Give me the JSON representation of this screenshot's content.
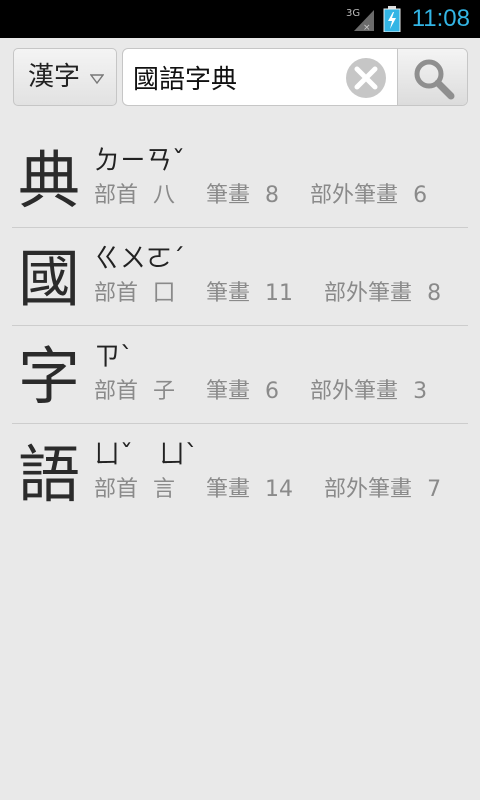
{
  "status_bar": {
    "network": "3G",
    "time": "11:08",
    "accent_color": "#33b5e5"
  },
  "search": {
    "mode_label": "漢字",
    "query": "國語字典",
    "clear_icon": "clear-icon",
    "search_icon": "search-icon"
  },
  "results": [
    {
      "char": "典",
      "zhuyin": "ㄉㄧㄢˇ",
      "radical_label": "部首",
      "radical": "八",
      "strokes_label": "筆畫",
      "strokes": "8",
      "extra_label": "部外筆畫",
      "extra": "6"
    },
    {
      "char": "國",
      "zhuyin": "ㄍㄨㄛˊ",
      "radical_label": "部首",
      "radical": "囗",
      "strokes_label": "筆畫",
      "strokes": "11",
      "extra_label": "部外筆畫",
      "extra": "8"
    },
    {
      "char": "字",
      "zhuyin": "ㄗˋ",
      "radical_label": "部首",
      "radical": "子",
      "strokes_label": "筆畫",
      "strokes": "6",
      "extra_label": "部外筆畫",
      "extra": "3"
    },
    {
      "char": "語",
      "zhuyin": "ㄩˇ　ㄩˋ",
      "radical_label": "部首",
      "radical": "言",
      "strokes_label": "筆畫",
      "strokes": "14",
      "extra_label": "部外筆畫",
      "extra": "7"
    }
  ]
}
